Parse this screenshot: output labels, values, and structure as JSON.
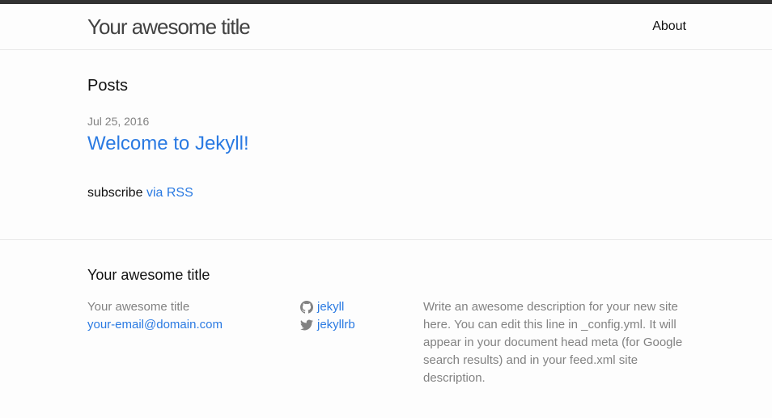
{
  "header": {
    "site_title": "Your awesome title",
    "nav": {
      "about": "About"
    }
  },
  "main": {
    "heading": "Posts",
    "posts": [
      {
        "date": "Jul 25, 2016",
        "title": "Welcome to Jekyll!"
      }
    ],
    "subscribe_prefix": "subscribe",
    "subscribe_link": "via RSS"
  },
  "footer": {
    "heading": "Your awesome title",
    "name": "Your awesome title",
    "email": "your-email@domain.com",
    "social": {
      "github_username": "jekyll",
      "twitter_username": "jekyllrb"
    },
    "description": "Write an awesome description for your new site here. You can edit this line in _config.yml. It will appear in your document head meta (for Google search results) and in your feed.xml site description."
  },
  "colors": {
    "link": "#2a7ae2",
    "meta": "#828282",
    "header_border_top": "#333333",
    "divider": "#e8e8e8",
    "background": "#fdfdfd"
  },
  "icons": {
    "github": "github-icon",
    "twitter": "twitter-icon"
  }
}
